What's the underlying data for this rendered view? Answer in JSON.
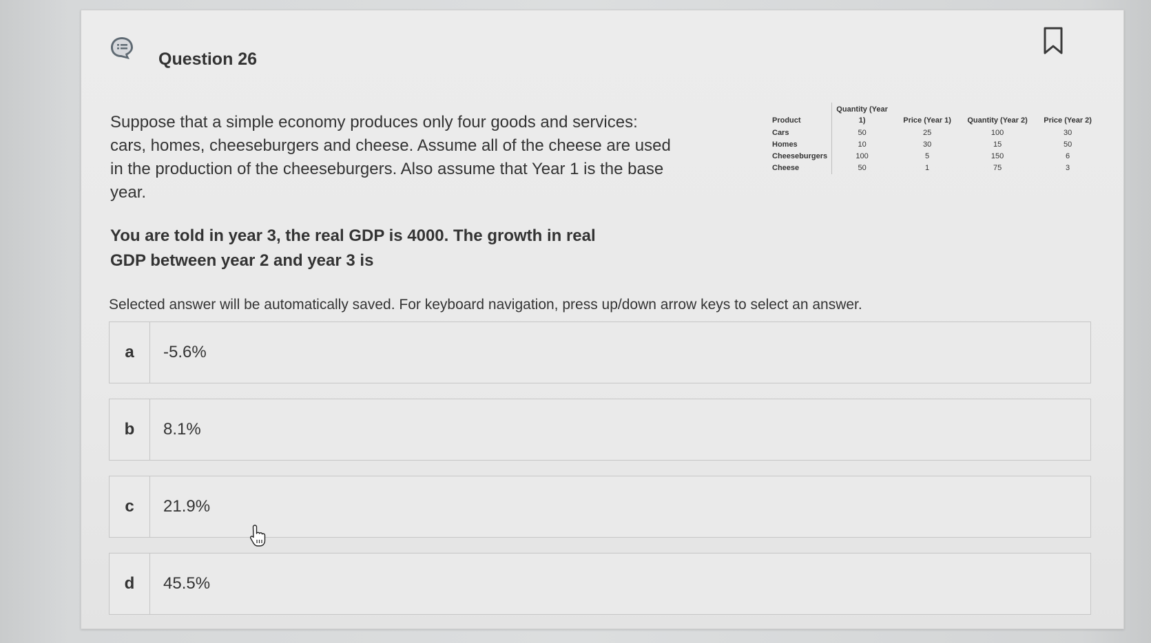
{
  "question": {
    "title": "Question 26",
    "prompt": "Suppose that a simple economy produces only four goods and services: cars, homes, cheeseburgers and cheese. Assume all of the cheese are used in the production of the cheeseburgers. Also assume that Year 1 is the base year.",
    "ask": "You are told in year 3, the real GDP is 4000. The growth in real GDP between year 2 and year 3 is",
    "instruction": "Selected answer will be automatically saved. For keyboard navigation, press up/down arrow keys to select an answer."
  },
  "table": {
    "headers": [
      "Product",
      "Quantity (Year 1)",
      "Price (Year 1)",
      "Quantity (Year 2)",
      "Price (Year 2)"
    ],
    "rows": [
      [
        "Cars",
        "50",
        "25",
        "100",
        "30"
      ],
      [
        "Homes",
        "10",
        "30",
        "15",
        "50"
      ],
      [
        "Cheeseburgers",
        "100",
        "5",
        "150",
        "6"
      ],
      [
        "Cheese",
        "50",
        "1",
        "75",
        "3"
      ]
    ]
  },
  "options": [
    {
      "letter": "a",
      "text": "-5.6%"
    },
    {
      "letter": "b",
      "text": "8.1%"
    },
    {
      "letter": "c",
      "text": "21.9%"
    },
    {
      "letter": "d",
      "text": "45.5%"
    }
  ],
  "icons": {
    "question_icon": "chat-list-icon",
    "bookmark": "bookmark-icon",
    "cursor": "hand-pointer-icon"
  },
  "colors": {
    "card_bg": "#ebebeb",
    "border": "#c6c6c6",
    "text": "#333333"
  }
}
